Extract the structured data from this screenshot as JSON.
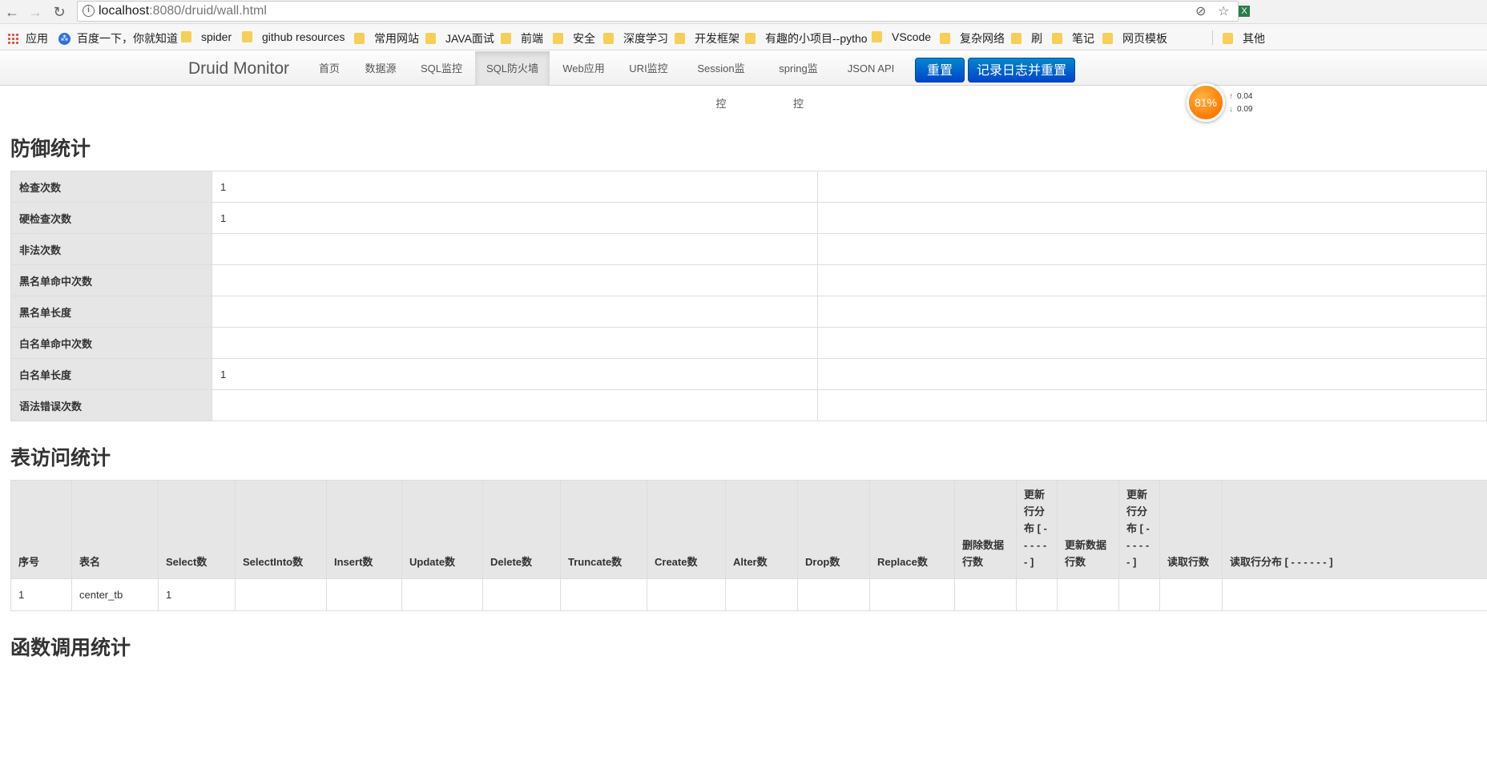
{
  "browser": {
    "url_host": "localhost",
    "url_path": ":8080/druid/wall.html",
    "bookmarks": [
      {
        "icon": "apps-grid-icon",
        "label": "应用"
      },
      {
        "icon": "baidu-icon",
        "label": "百度一下，你就知道"
      },
      {
        "icon": "folder-icon",
        "label": "spider"
      },
      {
        "icon": "folder-icon",
        "label": "github resources"
      },
      {
        "icon": "folder-icon",
        "label": "常用网站"
      },
      {
        "icon": "folder-icon",
        "label": "JAVA面试"
      },
      {
        "icon": "folder-icon",
        "label": "前端"
      },
      {
        "icon": "folder-icon",
        "label": "安全"
      },
      {
        "icon": "folder-icon",
        "label": "深度学习"
      },
      {
        "icon": "folder-icon",
        "label": "开发框架"
      },
      {
        "icon": "folder-icon",
        "label": "有趣的小项目--pytho"
      },
      {
        "icon": "folder-icon",
        "label": "VScode"
      },
      {
        "icon": "folder-icon",
        "label": "复杂网络"
      },
      {
        "icon": "folder-icon",
        "label": "刷"
      },
      {
        "icon": "folder-icon",
        "label": "笔记"
      },
      {
        "icon": "folder-icon",
        "label": "网页模板"
      },
      {
        "icon": "folder-icon",
        "label": "其他"
      }
    ]
  },
  "navbar": {
    "brand": "Druid Monitor",
    "items": [
      "首页",
      "数据源",
      "SQL监控",
      "SQL防火墙",
      "Web应用",
      "URI监控",
      "Session监控",
      "spring监控",
      "JSON API"
    ],
    "active": "SQL防火墙",
    "reset_label": "重置",
    "log_reset_label": "记录日志并重置"
  },
  "speed_widget": {
    "percent": "81%",
    "up": "0.04",
    "down": "0.09"
  },
  "defense": {
    "title": "防御统计",
    "rows": [
      {
        "label": "检查次数",
        "value": "1"
      },
      {
        "label": "硬检查次数",
        "value": "1"
      },
      {
        "label": "非法次数",
        "value": ""
      },
      {
        "label": "黑名单命中次数",
        "value": ""
      },
      {
        "label": "黑名单长度",
        "value": ""
      },
      {
        "label": "白名单命中次数",
        "value": ""
      },
      {
        "label": "白名单长度",
        "value": "1"
      },
      {
        "label": "语法错误次数",
        "value": ""
      }
    ]
  },
  "table_access": {
    "title": "表访问统计",
    "headers": [
      "序号",
      "表名",
      "Select数",
      "SelectInto数",
      "Insert数",
      "Update数",
      "Delete数",
      "Truncate数",
      "Create数",
      "Alter数",
      "Drop数",
      "Replace数",
      "删除数据行数",
      "更新行分布 [ - - - - - - ]",
      "更新数据行数",
      "更新行分布 [ - - - - - - ]",
      "读取行数",
      "读取行分布 [ - - - - - - ]"
    ],
    "rows": [
      [
        "1",
        "center_tb",
        "1",
        "",
        "",
        "",
        "",
        "",
        "",
        "",
        "",
        "",
        "",
        "",
        "",
        "",
        "",
        ""
      ]
    ]
  },
  "function_stats": {
    "title": "函数调用统计"
  }
}
